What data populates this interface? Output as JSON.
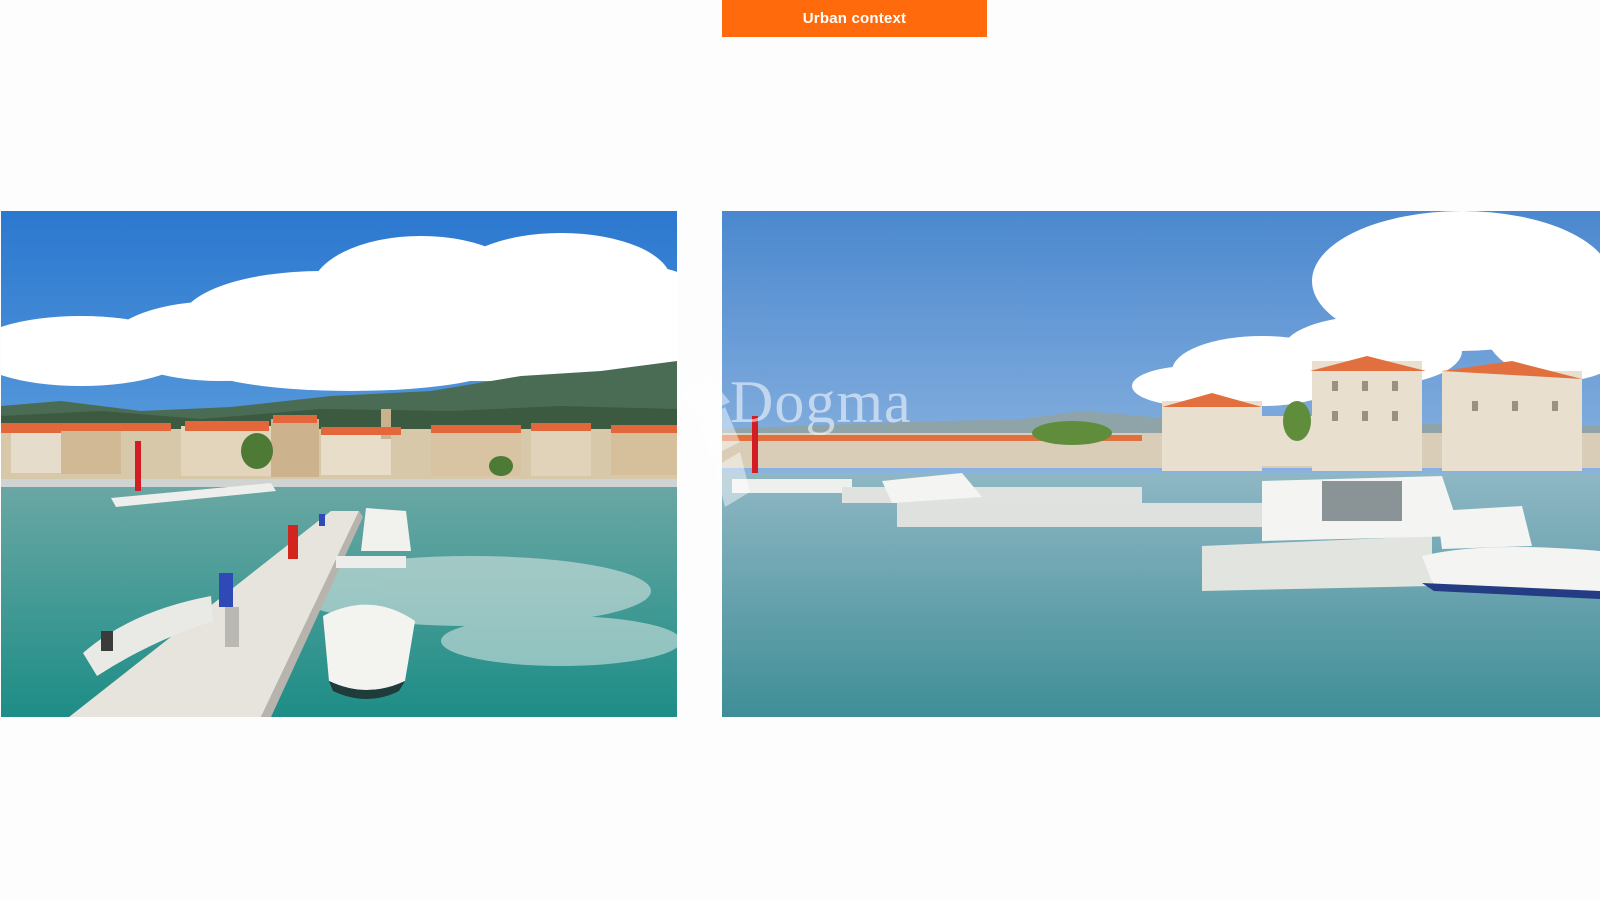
{
  "header": {
    "title": "Urban context"
  },
  "watermark": {
    "text": "Dogma"
  },
  "photos": [
    {
      "name": "left-harbor-photo"
    },
    {
      "name": "right-harbor-photo"
    }
  ],
  "colors": {
    "accent": "#ff6a0d",
    "background": "#fdfdfd"
  }
}
